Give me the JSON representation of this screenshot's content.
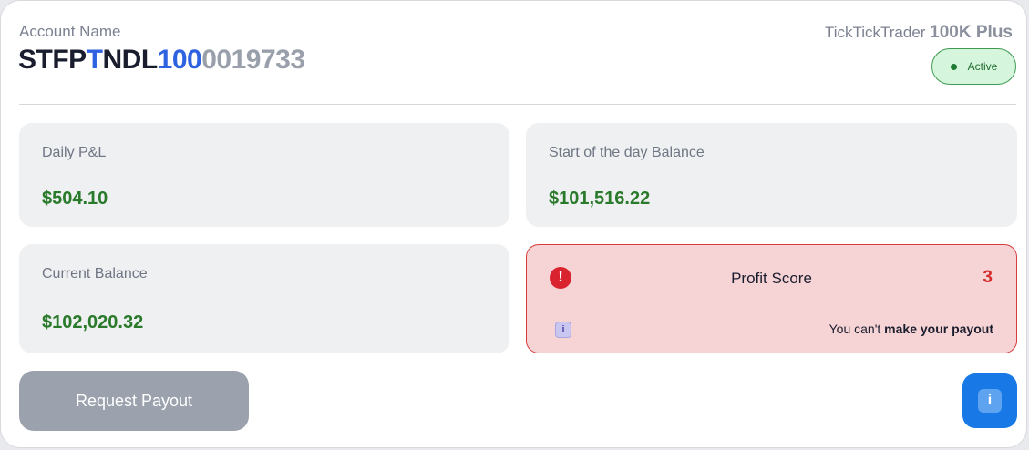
{
  "account": {
    "label": "Account Name",
    "id_parts": [
      "STFP",
      "T",
      "NDL",
      "100",
      "0019733"
    ],
    "provider": "TickTickTrader",
    "plan": "100K Plus",
    "status": "Active"
  },
  "stats": {
    "daily_pnl": {
      "label": "Daily P&L",
      "value": "$504.10"
    },
    "start_balance": {
      "label": "Start of the day Balance",
      "value": "$101,516.22"
    },
    "current_balance": {
      "label": "Current Balance",
      "value": "$102,020.32"
    }
  },
  "profit_score": {
    "title": "Profit Score",
    "score": "3",
    "message_prefix": "You can't ",
    "message_bold": "make your payout",
    "alert_glyph": "!",
    "info_glyph": "i"
  },
  "actions": {
    "request_payout": "Request Payout",
    "info_glyph": "i"
  },
  "colors": {
    "positive": "#2a7a2c",
    "negative": "#d42a2a",
    "accent": "#1778e6",
    "active_bg": "#d5f5dc"
  }
}
